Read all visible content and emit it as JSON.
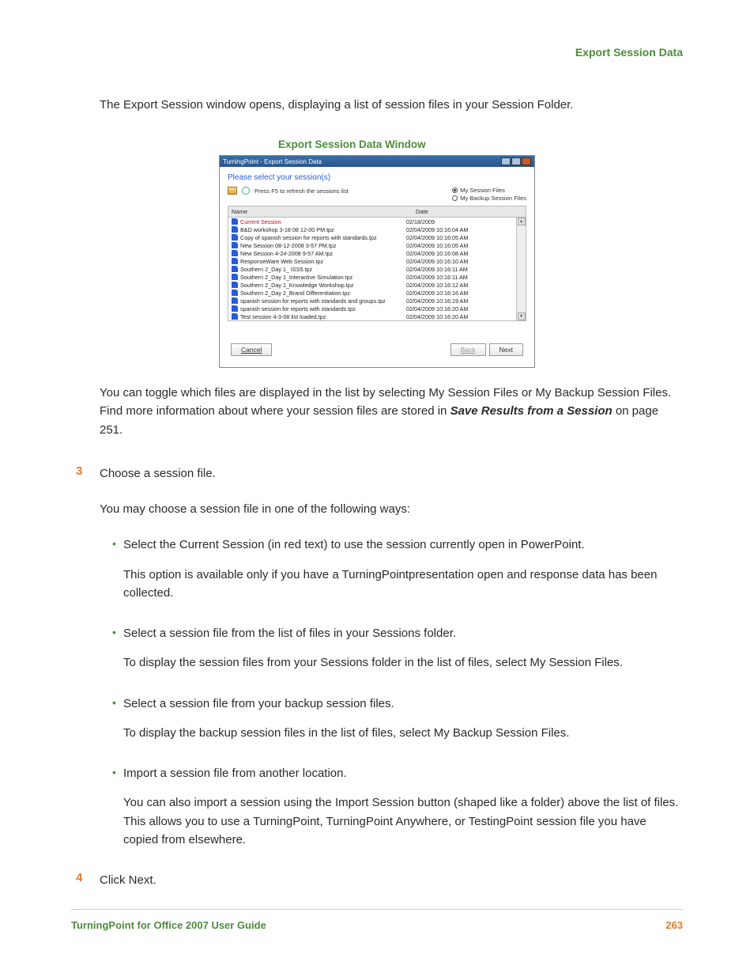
{
  "header": {
    "title": "Export Session Data"
  },
  "intro": "The Export Session window opens, displaying a list of session files in your Session Folder.",
  "figure_caption": "Export Session Data Window",
  "screenshot": {
    "titlebar": "TurningPoint - Export Session Data",
    "prompt": "Please select your session(s)",
    "refresh_hint": "Press F5 to refresh the sessions list",
    "radio_session": "My Session Files",
    "radio_backup": "My Backup Session Files",
    "col_name": "Name",
    "col_date": "Date",
    "rows": [
      {
        "name": "Current Session",
        "date": "02/18/2009",
        "current": true
      },
      {
        "name": "B&D workshop 3-18 08 12-00 PM.tpz",
        "date": "02/04/2009 10:16:04 AM"
      },
      {
        "name": "Copy of spanish session for reports with standards.tpz",
        "date": "02/04/2009 10:16:05 AM"
      },
      {
        "name": "New Session 08-12-2008 3-57 PM.tpz",
        "date": "02/04/2009 10:16:05 AM"
      },
      {
        "name": "New Session 4-24-2008 9-57 AM.tpz",
        "date": "02/04/2009 10:16:08 AM"
      },
      {
        "name": "ResponseWare Web Session.tpz",
        "date": "02/04/2009 10:16:10 AM"
      },
      {
        "name": "Southern 2_Day 1_ ISS5.tpz",
        "date": "02/04/2009 10:16:11 AM"
      },
      {
        "name": "Southern 2_Day 1_Interactive Simulation.tpz",
        "date": "02/04/2009 10:16:11 AM"
      },
      {
        "name": "Southern 2_Day 1_Knowledge Workshop.tpz",
        "date": "02/04/2009 10:16:12 AM"
      },
      {
        "name": "Southern 2_Day 2_Brand Differentiation.tpz",
        "date": "02/04/2009 10:16:16 AM"
      },
      {
        "name": "spanish session for reports with standards and groups.tpz",
        "date": "02/04/2009 10:16:19 AM"
      },
      {
        "name": "spanish session for reports with standards.tpz",
        "date": "02/04/2009 10:16:20 AM"
      },
      {
        "name": "Test session 4-3-08 list loaded.tpz",
        "date": "02/04/2009 10:16:20 AM"
      }
    ],
    "btn_cancel": "Cancel",
    "btn_back": "Back",
    "btn_next": "Next"
  },
  "para_toggle_pre": "You can toggle which files are displayed in the list by selecting My Session Files or My Backup Session Files. Find more information about where your session files are stored in ",
  "save_ref": "Save Results from a Session",
  "para_toggle_post": " on page 251.",
  "step3": {
    "num": "3",
    "text": "Choose a session file.",
    "intro": "You may choose a session file in one of the following ways:",
    "bullets": [
      {
        "lead": "Select the Current Session (in red text) to use the session currently open in PowerPoint.",
        "detail": "This option is available only if you have a TurningPointpresentation open and response data has been collected."
      },
      {
        "lead": "Select a session file from the list of files in your Sessions folder.",
        "detail": "To display the session files from your Sessions folder in the list of files, select My Session Files."
      },
      {
        "lead": "Select a session file from your backup session files.",
        "detail": "To display the backup session files in the list of files, select My Backup Session Files."
      },
      {
        "lead": "Import a session file from another location.",
        "detail": "You can also import a session using the Import Session button (shaped like a folder) above the list of files. This allows you to use a TurningPoint, TurningPoint Anywhere, or TestingPoint session file you have copied from elsewhere."
      }
    ]
  },
  "step4": {
    "num": "4",
    "text": "Click Next."
  },
  "footer": {
    "left": "TurningPoint for Office 2007 User Guide",
    "right": "263"
  }
}
